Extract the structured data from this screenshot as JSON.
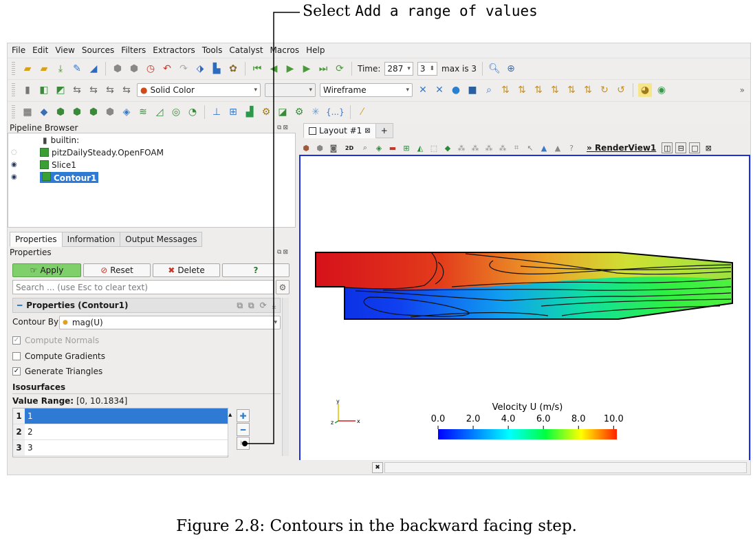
{
  "annotation": {
    "prefix": "Select",
    "code": "Add a range of values"
  },
  "menu": [
    "File",
    "Edit",
    "View",
    "Sources",
    "Filters",
    "Extractors",
    "Tools",
    "Catalyst",
    "Macros",
    "Help"
  ],
  "toolbar1": {
    "time_label": "Time:",
    "time_value": "287",
    "step_value": "3",
    "max_label": "max is 3"
  },
  "toolbar2": {
    "color_by": "Solid Color",
    "representation": "Wireframe",
    "more": "»"
  },
  "toolbar3": {
    "braces": "{...}"
  },
  "pipeline": {
    "title": "Pipeline Browser",
    "items": [
      {
        "label": "builtin:"
      },
      {
        "label": "pitzDailySteady.OpenFOAM"
      },
      {
        "label": "Slice1"
      },
      {
        "label": "Contour1"
      }
    ]
  },
  "tabs": [
    "Properties",
    "Information",
    "Output Messages"
  ],
  "properties": {
    "title": "Properties",
    "apply": "Apply",
    "reset": "Reset",
    "delete": "Delete",
    "help": "?",
    "search_placeholder": "Search ... (use Esc to clear text)",
    "section": "Properties (Contour1)",
    "contour_by_label": "Contour By",
    "contour_by_value": "mag(U)",
    "compute_normals": "Compute Normals",
    "compute_gradients": "Compute Gradients",
    "generate_triangles": "Generate Triangles",
    "isosurfaces": "Isosurfaces",
    "value_range_label": "Value Range:",
    "value_range": "[0, 10.1834]",
    "rows": [
      {
        "num": "1",
        "value": "1"
      },
      {
        "num": "2",
        "value": "2"
      },
      {
        "num": "3",
        "value": "3"
      }
    ]
  },
  "layout": {
    "tab": "Layout #1",
    "close": "⊠",
    "plus": "+",
    "view_name": "RenderView1",
    "twod": "2D"
  },
  "colorbar": {
    "title": "Velocity U (m/s)",
    "ticks": [
      "0.0",
      "2.0",
      "4.0",
      "6.0",
      "8.0",
      "10.0"
    ],
    "range": [
      0,
      10.1834
    ]
  },
  "caption": "Figure 2.8: Contours in the backward facing step."
}
